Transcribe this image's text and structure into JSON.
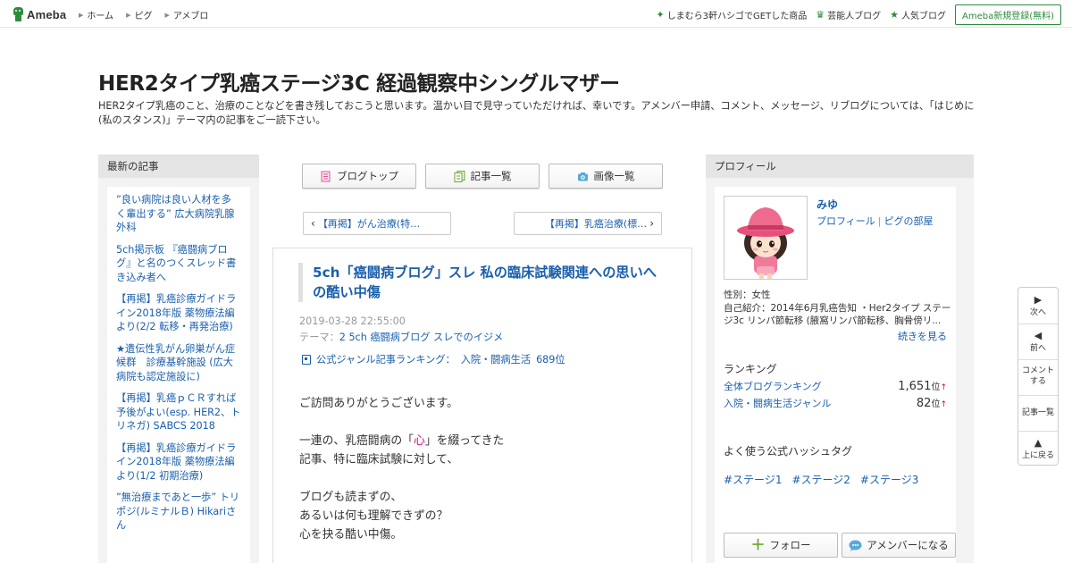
{
  "topbar": {
    "logo_text": "Ameba",
    "nav": [
      {
        "label": "ホーム"
      },
      {
        "label": "ピグ"
      },
      {
        "label": "アメブロ"
      }
    ],
    "right": [
      {
        "label": "しまむら3軒ハシゴでGETした商品",
        "icon": "sparkle-icon"
      },
      {
        "label": "芸能人ブログ",
        "icon": "crown-icon"
      },
      {
        "label": "人気ブログ",
        "icon": "star-icon"
      }
    ],
    "signup_label": "Ameba新規登録(無料)"
  },
  "header": {
    "title": "HER2タイプ乳癌ステージ3C 経過観察中シングルマザー",
    "description": "HER2タイプ乳癌のこと、治療のことなどを書き残しておこうと思います。温かい目で見守っていただければ、幸いです。アメンバー申請、コメント、メッセージ、リブログについては、「はじめに(私のスタンス)」テーマ内の記事をご一読下さい。"
  },
  "left_sidebar": {
    "heading": "最新の記事",
    "items": [
      {
        "label": "”良い病院は良い人材を多く輩出する” 広大病院乳腺外科"
      },
      {
        "label": "5ch掲示板 『癌闘病ブログ』と名のつくスレッド書き込み者へ"
      },
      {
        "label": "【再掲】乳癌診療ガイドライン2018年版 薬物療法編より(2/2 転移・再発治療)"
      },
      {
        "label": "★遺伝性乳がん卵巣がん症候群　診療基幹施設 (広大病院も認定施設に)"
      },
      {
        "label": "【再掲】乳癌ｐＣＲすれば予後がよい(esp. HER2、トリネガ) SABCS 2018"
      },
      {
        "label": "【再掲】乳癌診療ガイドライン2018年版 薬物療法編より(1/2 初期治療)"
      },
      {
        "label": "”無治療まであと一歩” トリポジ(ルミナルＢ) Hikariさん"
      }
    ]
  },
  "center": {
    "nav_buttons": [
      {
        "label": "ブログトップ",
        "icon": "document-icon"
      },
      {
        "label": "記事一覧",
        "icon": "list-icon"
      },
      {
        "label": "画像一覧",
        "icon": "camera-icon"
      }
    ],
    "prev_label": "【再掲】がん治療(特…",
    "next_label": "【再掲】乳癌治療(標…",
    "article": {
      "title": "5ch「癌闘病ブログ」スレ 私の臨床試験関連への思いへの酷い中傷",
      "date": "2019-03-28 22:55:00",
      "theme_prefix": "テーマ：",
      "theme": "2 5ch 癌闘病ブログ スレでのイジメ",
      "rank_label": "公式ジャンル記事ランキング：",
      "rank_genre": "入院・闘病生活",
      "rank_value": "689位",
      "body": {
        "line1": "ご訪問ありがとうございます。",
        "line2_pre": "一連の、乳癌闘病の「",
        "line2_kokoro": "心",
        "line2_post": "」を綴ってきた",
        "line3": "記事、特に臨床試験に対して、",
        "line4": "ブログも読まずの、",
        "line5": "あるいは何も理解できずの？",
        "line6": "心を抉る酷い中傷。"
      }
    }
  },
  "right_sidebar": {
    "heading": "プロフィール",
    "name": "みゆ",
    "profile_link": "プロフィール",
    "room_link": "ピグの部屋",
    "gender": "性別：女性",
    "intro": "自己紹介：2014年6月乳癌告知 ・Her2タイプ ステージ3c リンパ節転移 (腋窩リンパ節転移、胸骨傍リ...",
    "more_label": "続きを見る",
    "ranking_heading": "ランキング",
    "rankings": [
      {
        "label": "全体ブログランキング",
        "value": "1,651",
        "unit": "位",
        "trend": "↑"
      },
      {
        "label": "入院・闘病生活ジャンル",
        "value": "82",
        "unit": "位",
        "trend": "↑"
      }
    ],
    "hashtag_heading": "よく使う公式ハッシュタグ",
    "hashtags": [
      "#ステージ1",
      "#ステージ2",
      "#ステージ3"
    ],
    "follow_label": "フォロー",
    "amember_label": "アメンバーになる"
  },
  "float_nav": {
    "next": "次へ",
    "prev": "前へ",
    "comment": "コメントする",
    "list": "記事一覧",
    "top": "上に戻る"
  },
  "colors": {
    "link": "#1a5fad",
    "ameba_green": "#2d8c3c",
    "kokoro_pink": "#e4007f",
    "panel_bg": "#f3f3f3"
  }
}
